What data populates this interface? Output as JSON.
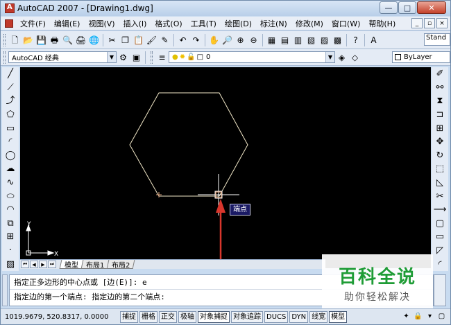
{
  "window": {
    "title": "AutoCAD 2007 - [Drawing1.dwg]",
    "buttons": {
      "minimize": "—",
      "maximize": "□",
      "close": "✕"
    }
  },
  "menu": {
    "items": [
      "文件(F)",
      "编辑(E)",
      "视图(V)",
      "插入(I)",
      "格式(O)",
      "工具(T)",
      "绘图(D)",
      "标注(N)",
      "修改(M)",
      "窗口(W)",
      "帮助(H)"
    ],
    "right_buttons": [
      "_",
      "▫",
      "×"
    ]
  },
  "toolbar": {
    "text_style": "Stand",
    "workspace": "AutoCAD 经典",
    "layer": "0",
    "color": "ByLayer"
  },
  "drawing": {
    "background": "#000000",
    "line_color": "#f2e8c8",
    "crosshair_color": "#ffffff",
    "tooltip": "端点",
    "ucs": {
      "x": "X",
      "y": "Y"
    }
  },
  "layout_tabs": [
    "模型",
    "布局1",
    "布局2"
  ],
  "command": {
    "line1": "指定正多边形的中心点或 [边(E)]: e",
    "line2": "指定边的第一个端点: 指定边的第二个端点:"
  },
  "status": {
    "coords": "1019.9679, 520.8317, 0.0000",
    "buttons": [
      "捕捉",
      "栅格",
      "正交",
      "极轴",
      "对象捕捉",
      "对象追踪",
      "DUCS",
      "DYN",
      "线宽",
      "模型"
    ],
    "active": [
      "对象捕捉",
      "模型"
    ]
  },
  "watermark": {
    "title": "百科全说",
    "subtitle": "助你轻松解决"
  },
  "colors": {
    "accent_red": "#d9362c",
    "watermark_green": "#1f9c36"
  }
}
